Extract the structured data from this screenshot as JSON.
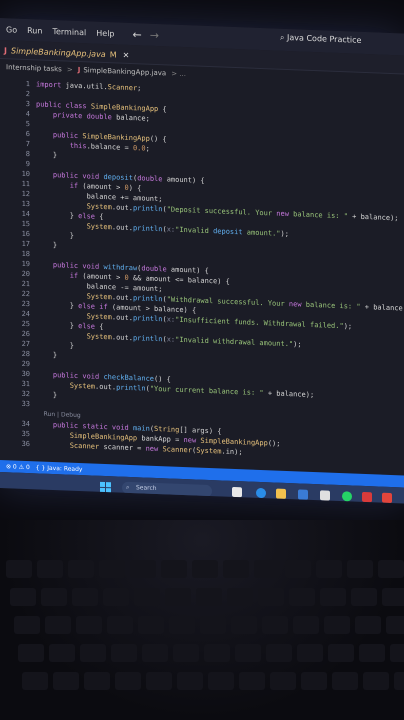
{
  "menu": {
    "items": [
      "Go",
      "Run",
      "Terminal",
      "Help"
    ],
    "back": "←",
    "forward": "→",
    "search": "Java Code Practice"
  },
  "tab": {
    "icon": "J",
    "name": "SimpleBankingApp.java",
    "modified": "M",
    "close": "✕"
  },
  "breadcrumb": {
    "folder": "Internship tasks",
    "sep1": ">",
    "file": "SimpleBankingApp.java",
    "sep2": "> ..."
  },
  "code": [
    {
      "n": "1",
      "t": "import java.util.Scanner;"
    },
    {
      "n": "2",
      "t": ""
    },
    {
      "n": "3",
      "t": "public class SimpleBankingApp {"
    },
    {
      "n": "4",
      "t": "    private double balance;"
    },
    {
      "n": "5",
      "t": ""
    },
    {
      "n": "6",
      "t": "    public SimpleBankingApp() {"
    },
    {
      "n": "7",
      "t": "        this.balance = 0.0;"
    },
    {
      "n": "8",
      "t": "    }"
    },
    {
      "n": "9",
      "t": ""
    },
    {
      "n": "10",
      "t": "    public void deposit(double amount) {"
    },
    {
      "n": "11",
      "t": "        if (amount > 0) {"
    },
    {
      "n": "12",
      "t": "            balance += amount;"
    },
    {
      "n": "13",
      "t": "            System.out.println(\"Deposit successful. Your new balance is: \" + balance);"
    },
    {
      "n": "14",
      "t": "        } else {"
    },
    {
      "n": "15",
      "t": "            System.out.println(x:\"Invalid deposit amount.\");"
    },
    {
      "n": "16",
      "t": "        }"
    },
    {
      "n": "17",
      "t": "    }"
    },
    {
      "n": "18",
      "t": ""
    },
    {
      "n": "19",
      "t": "    public void withdraw(double amount) {"
    },
    {
      "n": "20",
      "t": "        if (amount > 0 && amount <= balance) {"
    },
    {
      "n": "21",
      "t": "            balance -= amount;"
    },
    {
      "n": "22",
      "t": "            System.out.println(\"Withdrawal successful. Your new balance is: \" + balance);"
    },
    {
      "n": "23",
      "t": "        } else if (amount > balance) {"
    },
    {
      "n": "24",
      "t": "            System.out.println(x:\"Insufficient funds. Withdrawal failed.\");"
    },
    {
      "n": "25",
      "t": "        } else {"
    },
    {
      "n": "26",
      "t": "            System.out.println(x:\"Invalid withdrawal amount.\");"
    },
    {
      "n": "27",
      "t": "        }"
    },
    {
      "n": "28",
      "t": "    }"
    },
    {
      "n": "29",
      "t": ""
    },
    {
      "n": "30",
      "t": "    public void checkBalance() {"
    },
    {
      "n": "31",
      "t": "        System.out.println(\"Your current balance is: \" + balance);"
    },
    {
      "n": "32",
      "t": "    }"
    },
    {
      "n": "33",
      "t": ""
    },
    {
      "n": "",
      "t": "    Run | Debug"
    },
    {
      "n": "34",
      "t": "    public static void main(String[] args) {"
    },
    {
      "n": "35",
      "t": "        SimpleBankingApp bankApp = new SimpleBankingApp();"
    },
    {
      "n": "36",
      "t": "        Scanner scanner = new Scanner(System.in);"
    }
  ],
  "status": {
    "left": "⊗ 0 ⚠ 0",
    "java": "{ } Java: Ready"
  },
  "taskbar": {
    "search": "Search"
  },
  "colors": {
    "keyword": "#c678dd",
    "type": "#e5c07b",
    "function": "#61afef",
    "string": "#98c379",
    "number": "#d19a66",
    "statusbar": "#1f6feb"
  }
}
